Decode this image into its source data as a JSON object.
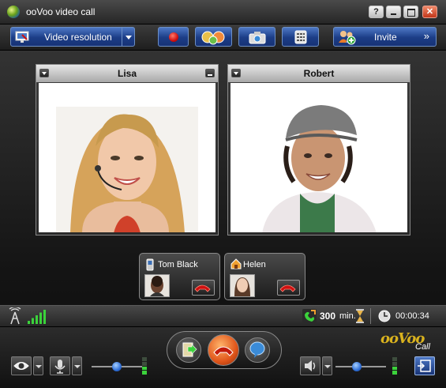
{
  "window": {
    "title": "ooVoo video call",
    "controls": {
      "help": "?",
      "minimize": "",
      "maximize": "",
      "close": "✕"
    }
  },
  "toolbar": {
    "video_resolution_label": "Video resolution",
    "invite_label": "Invite",
    "invite_chevron": "»"
  },
  "participants": [
    {
      "name": "Lisa"
    },
    {
      "name": "Robert"
    }
  ],
  "contacts": [
    {
      "name": "Tom Black",
      "device": "phone"
    },
    {
      "name": "Helen",
      "device": "home"
    }
  ],
  "status": {
    "minutes_value": "300",
    "minutes_unit": "min.",
    "call_timer": "00:00:34"
  },
  "brand": {
    "logo_text": "ooVoo",
    "logo_sub": "Call"
  },
  "colors": {
    "accent_blue": "#1c3d86",
    "signal_green": "#3bd23b",
    "hangup_red": "#d01010",
    "logo_gold": "#d9b21e"
  },
  "levels": {
    "signal_bars_lit": 5,
    "mic_volume": 0.5,
    "speaker_volume": 0.42,
    "mic_level_lit": 2,
    "speaker_level_lit": 2
  }
}
